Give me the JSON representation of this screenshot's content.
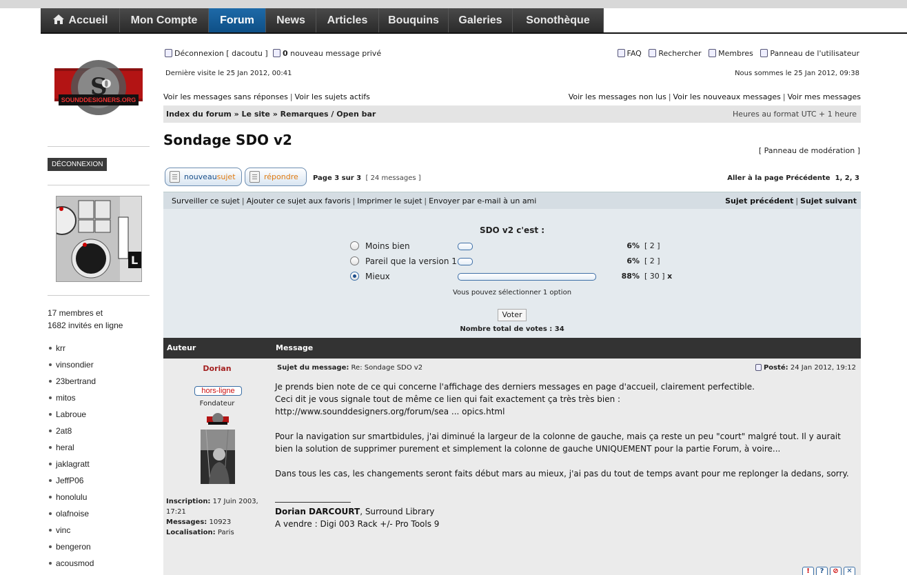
{
  "nav": {
    "items": [
      "Accueil",
      "Mon Compte",
      "Forum",
      "News",
      "Articles",
      "Bouquins",
      "Galeries",
      "Sonothèque"
    ],
    "active": "Forum"
  },
  "sidebar": {
    "logo_text": "SOUNDDESIGNERS.ORG",
    "logout_button": "DÉCONNEXION",
    "online_line1": "17 membres et",
    "online_line2": "1682 invités en ligne",
    "members": [
      "krr",
      "vinsondier",
      "23bertrand",
      "mitos",
      "Labroue",
      "2at8",
      "heral",
      "jaklagratt",
      "JeffP06",
      "honolulu",
      "olafnoise",
      "vinc",
      "bengeron",
      "acousmod"
    ]
  },
  "header": {
    "logout": "Déconnexion [ dacoutu ]",
    "pm_count": "0",
    "pm_text": "nouveau message privé",
    "faq": "FAQ",
    "search": "Rechercher",
    "members": "Membres",
    "user_panel": "Panneau de l'utilisateur",
    "last_visit": "Dernière visite le 25 Jan 2012, 00:41",
    "today": "Nous sommes le 25 Jan 2012, 09:38",
    "link_unanswered": "Voir les messages sans réponses",
    "link_active": "Voir les sujets actifs",
    "link_unread": "Voir les messages non lus",
    "link_new": "Voir les nouveaux messages",
    "link_mine": "Voir mes messages"
  },
  "breadcrumb": {
    "path": "Index du forum » Le site » Remarques / Open bar",
    "timezone": "Heures au format UTC + 1 heure"
  },
  "topic": {
    "title": "Sondage SDO v2",
    "mod_panel": "[ Panneau de modération ]",
    "btn_new_a": "nouveau",
    "btn_new_b": "sujet",
    "btn_reply": "répondre",
    "page_info": "Page 3 sur 3",
    "msg_count": "[ 24 messages ]",
    "goto_label": "Aller à la page Précédente",
    "pages": "1, 2, 3"
  },
  "toolbar": {
    "watch": "Surveiller ce sujet",
    "favorite": "Ajouter ce sujet aux favoris",
    "print": "Imprimer le sujet",
    "email": "Envoyer par e-mail à un ami",
    "prev": "Sujet précédent",
    "next": "Sujet suivant"
  },
  "poll": {
    "question": "SDO v2 c'est :",
    "options": [
      {
        "label": "Moins bien",
        "percent": 6,
        "pct_text": "6%",
        "count_text": "[ 2 ]",
        "selected": false
      },
      {
        "label": "Pareil que la version 1",
        "percent": 6,
        "pct_text": "6%",
        "count_text": "[ 2 ]",
        "selected": false
      },
      {
        "label": "Mieux",
        "percent": 88,
        "pct_text": "88%",
        "count_text": "[ 30 ]",
        "selected": true,
        "marker": "x"
      }
    ],
    "note": "Vous pouvez sélectionner 1 option",
    "vote_button": "Voter",
    "total": "Nombre total de votes : 34"
  },
  "post_table": {
    "col_author": "Auteur",
    "col_message": "Message"
  },
  "post": {
    "author": "Dorian",
    "status": "hors-ligne",
    "rank": "Fondateur",
    "joined_label": "Inscription:",
    "joined_value": "17 Juin 2003,",
    "joined_time": "17:21",
    "messages_label": "Messages:",
    "messages_value": "10923",
    "location_label": "Localisation:",
    "location_value": "Paris",
    "subject_label": "Sujet du message:",
    "subject_value": "Re: Sondage SDO v2",
    "posted_label": "Posté:",
    "posted_value": "24 Jan 2012, 19:12",
    "para1_line1": "Je prends bien note de ce qui concerne l'affichage des derniers messages en page d'accueil, clairement perfectible.",
    "para1_line2": "Ceci dit je vous signale tout de même ce lien qui fait exactement ça très très bien :",
    "para1_link": "http://www.sounddesigners.org/forum/sea ... opics.html",
    "para2": "Pour la navigation sur smartbidules, j'ai diminué la largeur de la colonne de gauche, mais ça reste un peu \"court\" malgré tout. Il y aurait bien la solution de supprimer purement et simplement la colonne de gauche UNIQUEMENT pour la partie Forum, à voire...",
    "para3": "Dans tous les cas, les changements seront faits début mars au mieux, j'ai pas du tout de temps avant pour me replonger la dedans, sorry.",
    "sig_name": "Dorian DARCOURT",
    "sig_rest": ", Surround Library",
    "sig_line2": "A vendre : Digi 003 Rack +/- Pro Tools 9"
  }
}
